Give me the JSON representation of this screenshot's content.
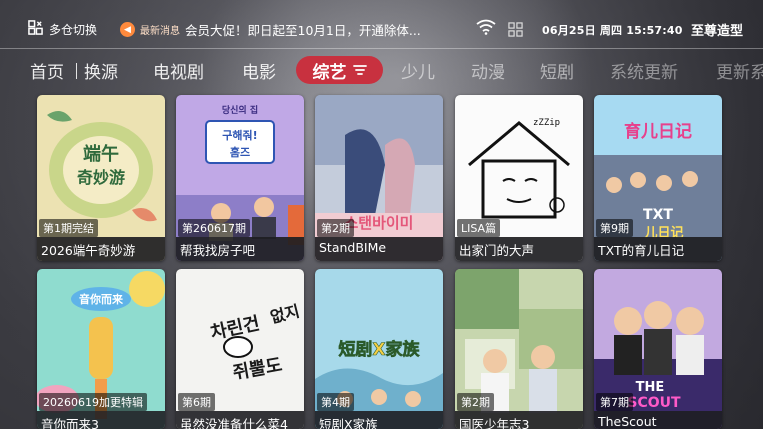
{
  "topbar": {
    "warehouse_label": "多仓切换",
    "news_label": "最新消息",
    "news_text": "会员大促！即日起至10月1日，开通除体...",
    "datetime": "06月25日 周四 15:57:40",
    "brand": "至尊造型"
  },
  "nav": {
    "items": [
      "首页",
      "换源",
      "电视剧",
      "电影",
      "综艺",
      "少儿",
      "动漫",
      "短剧",
      "系统更新",
      "更新系"
    ],
    "active": "综艺"
  },
  "grid": {
    "row1": [
      {
        "title": "2026端午奇妙游",
        "episode": "第1期完结",
        "poster_text": "端午奇妙游",
        "colors": [
          "#e9d9a0",
          "#b9c97a"
        ]
      },
      {
        "title": "帮我找房子吧",
        "episode": "第260617期",
        "poster_text": "구해줘! 홈즈",
        "colors": [
          "#b79be0",
          "#3d70c8"
        ]
      },
      {
        "title": "StandBIMe",
        "episode": "第2期",
        "poster_text": "스탠바이미",
        "colors": [
          "#b7c3d8",
          "#efc8cf"
        ]
      },
      {
        "title": "出家门的大声",
        "episode": "LISA篇",
        "poster_text": "zZZip",
        "colors": [
          "#ffffff",
          "#f2f2f2"
        ]
      },
      {
        "title": "TXT的育儿日记",
        "episode": "第9期",
        "poster_text": "育儿日记",
        "colors": [
          "#9bd6f0",
          "#5b6d8a"
        ]
      }
    ],
    "row2": [
      {
        "title": "音你而来3",
        "episode": "20260619加更特辑",
        "poster_text": "音你而来",
        "colors": [
          "#7ad8c8",
          "#f2d35a"
        ]
      },
      {
        "title": "虽然没准备什么菜4",
        "episode": "第6期",
        "poster_text": "차린건 쥐뿔도 없지만",
        "colors": [
          "#f4f4f2",
          "#ececea"
        ]
      },
      {
        "title": "短剧X家族",
        "episode": "第4期",
        "poster_text": "短剧X家族",
        "colors": [
          "#9fd4e8",
          "#f3d05a"
        ]
      },
      {
        "title": "国医少年志3",
        "episode": "第2期",
        "poster_text": "",
        "colors": [
          "#7fa870",
          "#c9d7b0"
        ]
      },
      {
        "title": "TheScout",
        "episode": "第7期",
        "poster_text": "THE SCOUT",
        "colors": [
          "#b59ad6",
          "#3a2a66"
        ]
      }
    ]
  }
}
